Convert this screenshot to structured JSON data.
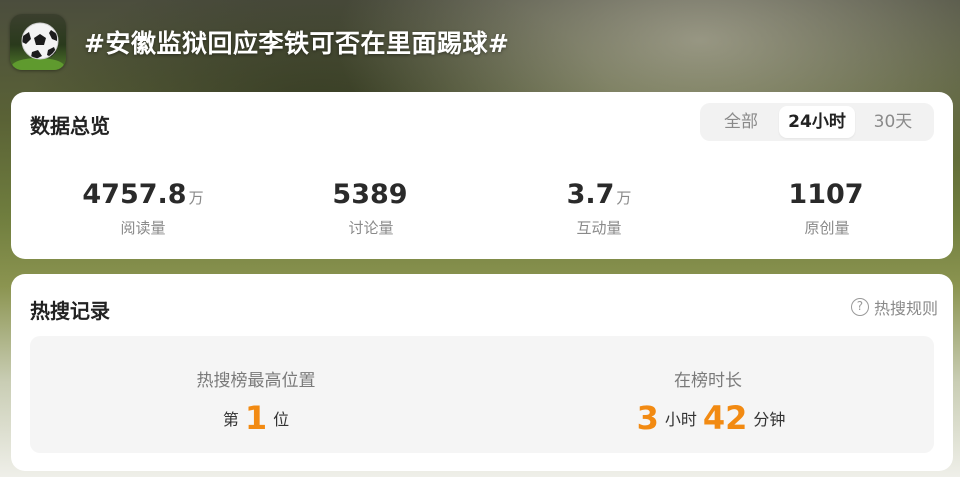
{
  "header": {
    "topic_title": "#安徽监狱回应李铁可否在里面踢球#",
    "icon": "soccer-ball-icon"
  },
  "overview": {
    "title": "数据总览",
    "tabs": [
      {
        "label": "全部",
        "active": false
      },
      {
        "label": "24小时",
        "active": true
      },
      {
        "label": "30天",
        "active": false
      }
    ],
    "stats": [
      {
        "value": "4757.8",
        "unit": "万",
        "label": "阅读量"
      },
      {
        "value": "5389",
        "unit": "",
        "label": "讨论量"
      },
      {
        "value": "3.7",
        "unit": "万",
        "label": "互动量"
      },
      {
        "value": "1107",
        "unit": "",
        "label": "原创量"
      }
    ]
  },
  "hot_search": {
    "title": "热搜记录",
    "rules_label": "热搜规则",
    "rules_icon": "question-circle-icon",
    "rank": {
      "label": "热搜榜最高位置",
      "prefix": "第",
      "value": "1",
      "suffix": "位"
    },
    "duration": {
      "label": "在榜时长",
      "hours": "3",
      "hours_unit": "小时",
      "minutes": "42",
      "minutes_unit": "分钟"
    }
  },
  "colors": {
    "accent": "#f28a12",
    "card_bg": "#ffffff",
    "muted_text": "#8a8a8a"
  }
}
